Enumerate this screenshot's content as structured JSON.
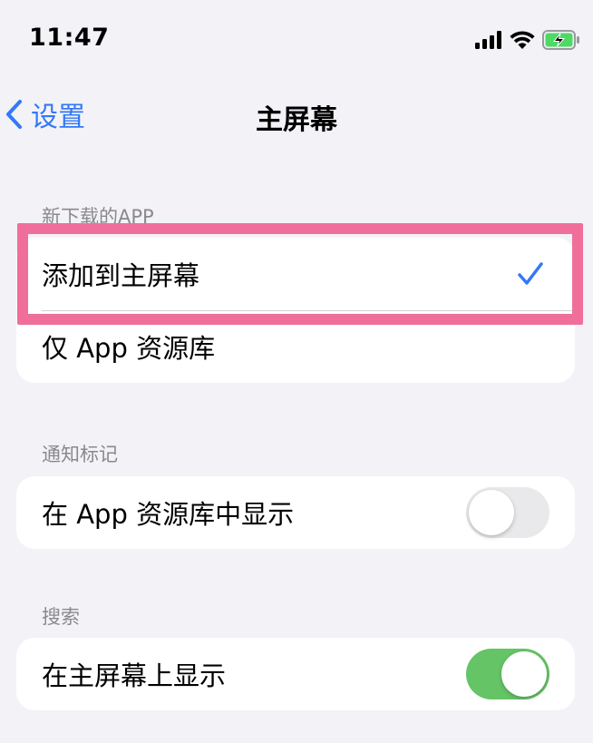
{
  "status_bar": {
    "time": "11:47",
    "icons": [
      "cellular-signal-icon",
      "wifi-icon",
      "battery-charging-icon"
    ]
  },
  "nav": {
    "back_label": "设置",
    "title": "主屏幕"
  },
  "sections": {
    "new_apps": {
      "header": "新下载的APP",
      "options": [
        {
          "label": "添加到主屏幕",
          "selected": true
        },
        {
          "label": "仅 App 资源库",
          "selected": false
        }
      ]
    },
    "badges": {
      "header": "通知标记",
      "row_label": "在 App 资源库中显示",
      "toggle_on": false
    },
    "search": {
      "header": "搜索",
      "row_label": "在主屏幕上显示",
      "toggle_on": true
    }
  },
  "colors": {
    "accent_blue": "#3478f6",
    "toggle_on_green": "#65c466",
    "toggle_off_gray": "#e9e9eb",
    "highlight_pink": "#ef6f9a",
    "background": "#f2f2f7"
  }
}
